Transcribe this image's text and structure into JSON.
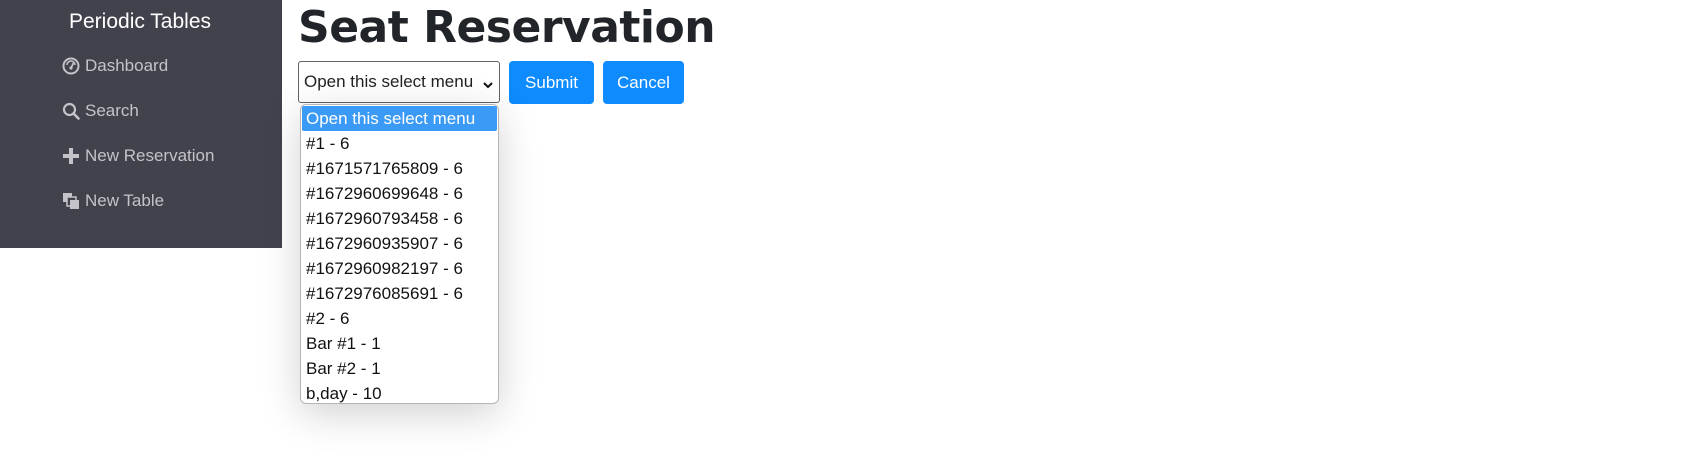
{
  "sidebar": {
    "brand": "Periodic Tables",
    "items": [
      {
        "label": "Dashboard",
        "icon": "dashboard-icon"
      },
      {
        "label": "Search",
        "icon": "search-icon"
      },
      {
        "label": "New Reservation",
        "icon": "plus-icon"
      },
      {
        "label": "New Table",
        "icon": "table-icon"
      }
    ]
  },
  "main": {
    "title": "Seat Reservation",
    "select": {
      "selected": "Open this select menu",
      "options": [
        "Open this select menu",
        "#1 - 6",
        "#1671571765809 - 6",
        "#1672960699648 - 6",
        "#1672960793458 - 6",
        "#1672960935907 - 6",
        "#1672960982197 - 6",
        "#1672976085691 - 6",
        "#2 - 6",
        "Bar #1 - 1",
        "Bar #2 - 1",
        "b,day - 10"
      ]
    },
    "submit_label": "Submit",
    "cancel_label": "Cancel"
  },
  "colors": {
    "sidebar_bg": "#42424d",
    "sidebar_text": "#c3c3c8",
    "primary": "#0d8bff",
    "option_highlight": "#3b9af5"
  }
}
